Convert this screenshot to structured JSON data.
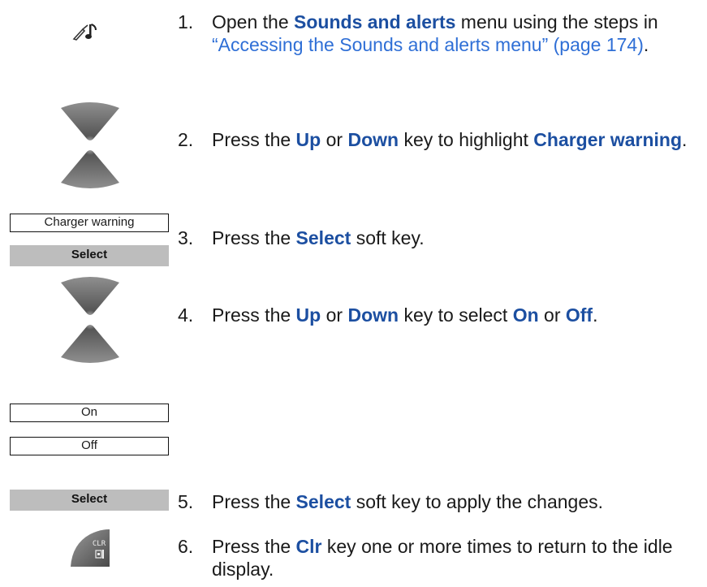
{
  "steps": [
    {
      "num": "1.",
      "pre": "Open the ",
      "bold1": "Sounds and alerts",
      "mid": " menu using the steps in ",
      "link": "“Accessing the Sounds and alerts menu” (page 174)",
      "post": "."
    },
    {
      "num": "2.",
      "pre": "Press the ",
      "b1": "Up",
      "or": " or ",
      "b2": "Down",
      "mid": " key to highlight ",
      "b3": "Charger warning",
      "post": "."
    },
    {
      "num": "3.",
      "pre": "Press the ",
      "b1": "Select",
      "post": " soft key."
    },
    {
      "num": "4.",
      "pre": "Press the ",
      "b1": "Up",
      "or": " or ",
      "b2": "Down",
      "mid": " key to select ",
      "b3": "On",
      "or2": " or ",
      "b4": "Off",
      "post": "."
    },
    {
      "num": "5.",
      "pre": "Press the ",
      "b1": "Select",
      "post": " soft key to apply the changes."
    },
    {
      "num": "6.",
      "pre": "Press the ",
      "b1": "Clr",
      "post": " key one or more times to return to the idle display."
    }
  ],
  "left_panel": {
    "charger_box": "Charger warning",
    "select_label_1": "Select",
    "on_box": "On",
    "off_box": "Off",
    "select_label_2": "Select",
    "clr_key": "CLR"
  },
  "icons": {
    "sounds_icon": "music-note-icon",
    "nav_key": "up-down-navigation-key-icon",
    "clr_key": "clear-key-icon"
  },
  "colors": {
    "keyword_blue": "#1c4fa1",
    "link_blue": "#2f6fd6",
    "softkey_gray": "#bdbdbd"
  }
}
